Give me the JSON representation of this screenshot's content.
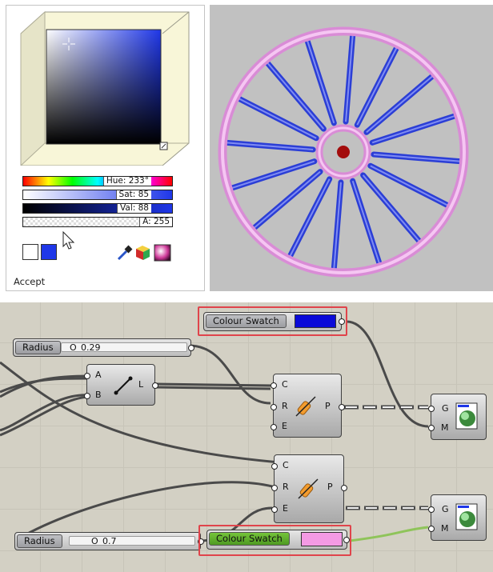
{
  "picker": {
    "hue_label": "Hue: 233°",
    "sat_label": "Sat: 85",
    "val_label": "Val: 88",
    "alpha_label": "A: 255",
    "accept_label": "Accept",
    "eyedropper_icon": "eyedropper-icon",
    "colors": {
      "current": "#1f37e8",
      "previous": "#ffffff"
    }
  },
  "canvas": {
    "radius1": {
      "name": "Radius",
      "value": "0.29"
    },
    "radius2": {
      "name": "Radius",
      "value": "0.7"
    },
    "swatch_blue": {
      "name": "Colour Swatch",
      "color": "#0a0ad8"
    },
    "swatch_pink": {
      "name": "Colour Swatch",
      "color": "#f49ae4"
    },
    "line_node": {
      "inputs": [
        "A",
        "B"
      ],
      "output": "L"
    },
    "pipe1": {
      "inputs": [
        "C",
        "R",
        "E"
      ],
      "output": "P"
    },
    "pipe2": {
      "inputs": [
        "C",
        "R",
        "E"
      ],
      "output": "P"
    },
    "preview1": {
      "inputs": [
        "G",
        "M"
      ]
    },
    "preview2": {
      "inputs": [
        "G",
        "M"
      ]
    }
  }
}
